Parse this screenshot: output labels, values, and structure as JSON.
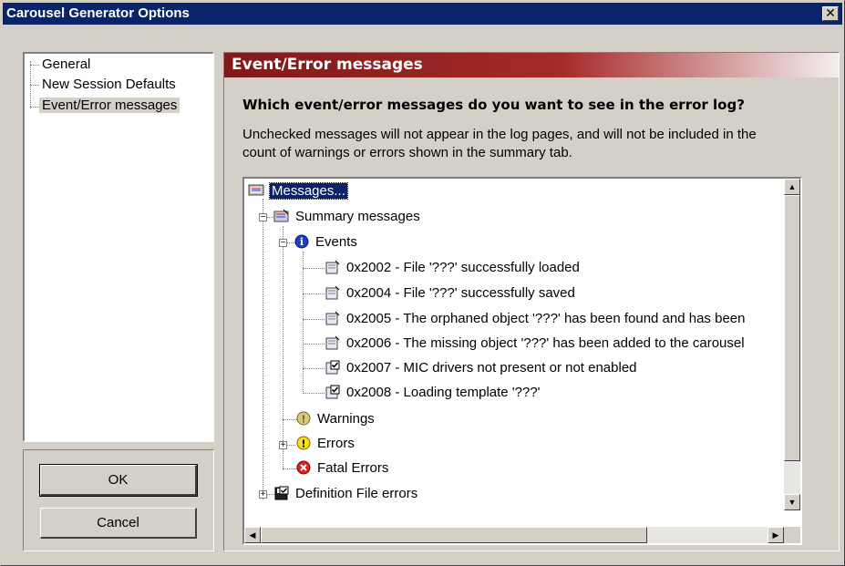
{
  "window": {
    "title": "Carousel Generator Options",
    "close_glyph": "✕"
  },
  "nav": {
    "items": [
      {
        "label": "General",
        "selected": false
      },
      {
        "label": "New Session Defaults",
        "selected": false
      },
      {
        "label": "Event/Error messages",
        "selected": true
      }
    ]
  },
  "buttons": {
    "ok": "OK",
    "cancel": "Cancel"
  },
  "panel": {
    "header": "Event/Error messages",
    "question": "Which event/error messages do you want to see in the error log?",
    "description_line1": "Unchecked messages will not appear in the log pages, and will not be included in the",
    "description_line2": "count of warnings or errors shown in the summary tab."
  },
  "tree": {
    "root": {
      "label": "Messages...",
      "icon": "messages-icon"
    },
    "summary": {
      "label": "Summary messages",
      "icon": "summary-icon",
      "expander": "−"
    },
    "events": {
      "label": "Events",
      "icon": "info-icon",
      "expander": "−"
    },
    "event_items": [
      {
        "label": "0x2002 - File '???' successfully loaded",
        "checked": false
      },
      {
        "label": "0x2004 - File '???' successfully saved",
        "checked": false
      },
      {
        "label": "0x2005 - The orphaned object '???' has been found and has been",
        "checked": false
      },
      {
        "label": "0x2006 - The missing object '???' has been added to the carousel",
        "checked": false
      },
      {
        "label": "0x2007 - MIC drivers not present or not enabled",
        "checked": true
      },
      {
        "label": "0x2008 - Loading template '???'",
        "checked": true
      }
    ],
    "warnings": {
      "label": "Warnings",
      "icon": "warning-icon"
    },
    "errors": {
      "label": "Errors",
      "icon": "error-icon",
      "expander": "+"
    },
    "fatal": {
      "label": "Fatal Errors",
      "icon": "fatal-error-icon"
    },
    "definition": {
      "label": "Definition File errors",
      "icon": "definition-file-icon",
      "expander": "+"
    }
  },
  "scroll_glyphs": {
    "up": "▲",
    "down": "▼",
    "left": "◀",
    "right": "▶"
  },
  "colors": {
    "titlebar": "#0a246a",
    "header_dark": "#7f1a1a",
    "info_blue": "#1f3fbf",
    "warning_yellow": "#f0e020",
    "fatal_red": "#e02020"
  }
}
